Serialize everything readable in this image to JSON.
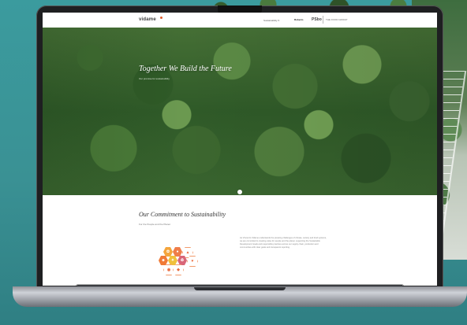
{
  "site": {
    "logo": "vidame",
    "header_menu": "Sustainability ▾",
    "brand_1": "Roberto",
    "brand_2": "PSbo",
    "brand_small": "THE FOOD GROUP"
  },
  "hero": {
    "title": "Together We Build the Future",
    "subtitle": "Our promise for sustainability"
  },
  "section": {
    "title": "Our Commitment to Sustainability",
    "subtitle": "For the People and the Planet",
    "paragraph": "As Vincenzo Vidame understands the pressing challenges of climate, society and food systems, we are committed to creating value for people and the planet, supporting the Sustainable Development Goals and responsible practices across our supply chain, production and communities with clear goals and transparent reporting."
  },
  "icons": [
    "leaf-icon",
    "drop-icon",
    "chart-icon",
    "people-icon",
    "energy-icon",
    "recycle-icon",
    "heart-icon",
    "globe-icon",
    "fish-icon"
  ],
  "colors": {
    "teal_background": "#3f9598",
    "forest": "#3a652f",
    "accent_orange": "#e05b2b",
    "hex_outline": "#f29a6b"
  }
}
